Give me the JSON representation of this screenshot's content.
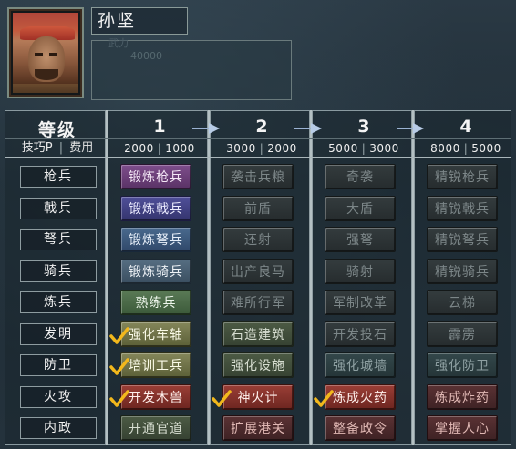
{
  "general": {
    "name": "孙坚",
    "faded_line1": "武力",
    "faded_line2": "40000"
  },
  "header": {
    "level_title": "等级",
    "sub_left": "技巧P",
    "sub_right": "费用",
    "levels": [
      {
        "num": "1",
        "skill": "2000",
        "cost": "1000"
      },
      {
        "num": "2",
        "skill": "3000",
        "cost": "2000"
      },
      {
        "num": "3",
        "skill": "5000",
        "cost": "3000"
      },
      {
        "num": "4",
        "skill": "8000",
        "cost": "5000"
      }
    ]
  },
  "rows": [
    {
      "label": "枪兵",
      "cells": [
        {
          "text": "锻炼枪兵",
          "style": "purple",
          "done": false
        },
        {
          "text": "袭击兵粮",
          "style": "grey",
          "done": false
        },
        {
          "text": "奇袭",
          "style": "grey",
          "done": false
        },
        {
          "text": "精锐枪兵",
          "style": "grey",
          "done": false
        }
      ]
    },
    {
      "label": "戟兵",
      "cells": [
        {
          "text": "锻炼戟兵",
          "style": "indigo",
          "done": false
        },
        {
          "text": "前盾",
          "style": "grey",
          "done": false
        },
        {
          "text": "大盾",
          "style": "grey",
          "done": false
        },
        {
          "text": "精锐戟兵",
          "style": "grey",
          "done": false
        }
      ]
    },
    {
      "label": "弩兵",
      "cells": [
        {
          "text": "锻炼弩兵",
          "style": "steel",
          "done": false
        },
        {
          "text": "还射",
          "style": "grey",
          "done": false
        },
        {
          "text": "强弩",
          "style": "grey",
          "done": false
        },
        {
          "text": "精锐弩兵",
          "style": "grey",
          "done": false
        }
      ]
    },
    {
      "label": "骑兵",
      "cells": [
        {
          "text": "锻炼骑兵",
          "style": "slate",
          "done": false
        },
        {
          "text": "出产良马",
          "style": "grey",
          "done": false
        },
        {
          "text": "骑射",
          "style": "grey",
          "done": false
        },
        {
          "text": "精锐骑兵",
          "style": "grey",
          "done": false
        }
      ]
    },
    {
      "label": "炼兵",
      "cells": [
        {
          "text": "熟练兵",
          "style": "green",
          "done": false
        },
        {
          "text": "难所行军",
          "style": "grey",
          "done": false
        },
        {
          "text": "军制改革",
          "style": "grey",
          "done": false
        },
        {
          "text": "云梯",
          "style": "grey",
          "done": false
        }
      ]
    },
    {
      "label": "发明",
      "cells": [
        {
          "text": "强化车轴",
          "style": "olive",
          "done": true
        },
        {
          "text": "石造建筑",
          "style": "olive-dim",
          "done": false
        },
        {
          "text": "开发投石",
          "style": "grey",
          "done": false
        },
        {
          "text": "霹雳",
          "style": "grey",
          "done": false
        }
      ]
    },
    {
      "label": "防卫",
      "cells": [
        {
          "text": "培训工兵",
          "style": "olive",
          "done": true
        },
        {
          "text": "强化设施",
          "style": "olive-dim",
          "done": false
        },
        {
          "text": "强化城墙",
          "style": "grey-teal",
          "done": false
        },
        {
          "text": "强化防卫",
          "style": "grey-teal",
          "done": false
        }
      ]
    },
    {
      "label": "火攻",
      "cells": [
        {
          "text": "开发木兽",
          "style": "red",
          "done": true
        },
        {
          "text": "神火计",
          "style": "red",
          "done": true
        },
        {
          "text": "炼成火药",
          "style": "red",
          "done": true
        },
        {
          "text": "炼成炸药",
          "style": "red-dim",
          "done": false
        }
      ]
    },
    {
      "label": "内政",
      "cells": [
        {
          "text": "开通官道",
          "style": "olive-dim",
          "done": false
        },
        {
          "text": "扩展港关",
          "style": "red-dim",
          "done": false
        },
        {
          "text": "整备政令",
          "style": "red-dim",
          "done": false
        },
        {
          "text": "掌握人心",
          "style": "red-dim",
          "done": false
        }
      ]
    }
  ]
}
